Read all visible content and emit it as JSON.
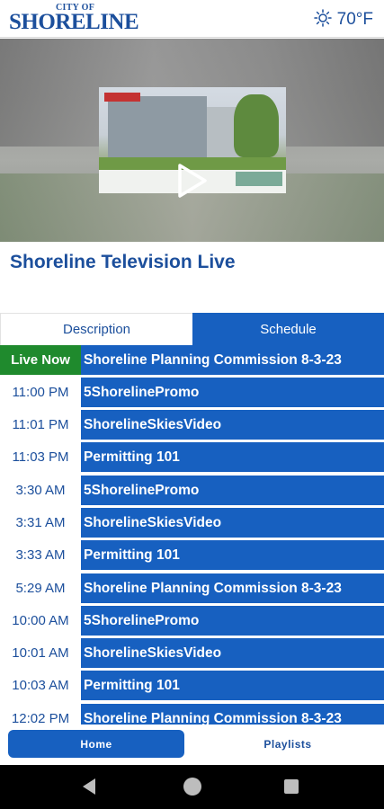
{
  "header": {
    "logo_small": "CITY OF",
    "logo_big": "SHORELINE",
    "weather_icon": "sun-icon",
    "temperature": "70°F"
  },
  "video": {
    "play_icon": "play-icon"
  },
  "page_title": "Shoreline Television Live",
  "tabs": [
    {
      "label": "Description",
      "active": false
    },
    {
      "label": "Schedule",
      "active": true
    }
  ],
  "schedule": [
    {
      "time": "Live Now",
      "program": "Shoreline Planning Commission 8-3-23",
      "live": true
    },
    {
      "time": "11:00 PM",
      "program": "5ShorelinePromo"
    },
    {
      "time": "11:01 PM",
      "program": "ShorelineSkiesVideo"
    },
    {
      "time": "11:03 PM",
      "program": "Permitting 101"
    },
    {
      "time": "3:30 AM",
      "program": "5ShorelinePromo"
    },
    {
      "time": "3:31 AM",
      "program": "ShorelineSkiesVideo"
    },
    {
      "time": "3:33 AM",
      "program": "Permitting 101"
    },
    {
      "time": "5:29 AM",
      "program": "Shoreline Planning Commission 8-3-23"
    },
    {
      "time": "10:00 AM",
      "program": "5ShorelinePromo"
    },
    {
      "time": "10:01 AM",
      "program": "ShorelineSkiesVideo"
    },
    {
      "time": "10:03 AM",
      "program": "Permitting 101"
    },
    {
      "time": "12:02 PM",
      "program": "Shoreline Planning Commission 8-3-23"
    }
  ],
  "bottom_nav": {
    "home_label": "Home",
    "playlists_label": "Playlists"
  },
  "colors": {
    "brand_blue": "#1c4f9c",
    "accent_blue": "#1760c0",
    "live_green": "#1f8a2d"
  }
}
